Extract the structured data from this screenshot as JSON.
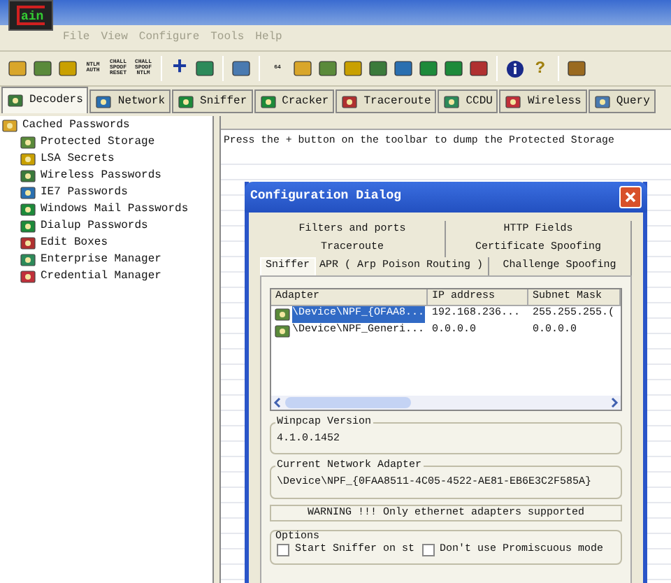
{
  "app": {
    "logo": "ain"
  },
  "menu": [
    "File",
    "View",
    "Configure",
    "Tools",
    "Help"
  ],
  "toolbar": [
    {
      "kind": "icon"
    },
    {
      "kind": "icon"
    },
    {
      "kind": "icon"
    },
    {
      "kind": "text",
      "label": "NTLM AUTH"
    },
    {
      "kind": "text",
      "label": "CHALL SPOOF RESET"
    },
    {
      "kind": "text",
      "label": "CHALL SPOOF NTLM"
    },
    {
      "kind": "sep"
    },
    {
      "kind": "plus",
      "label": "+"
    },
    {
      "kind": "icon"
    },
    {
      "kind": "sep"
    },
    {
      "kind": "icon"
    },
    {
      "kind": "sep"
    },
    {
      "kind": "text",
      "label": "64"
    },
    {
      "kind": "icon"
    },
    {
      "kind": "icon"
    },
    {
      "kind": "icon"
    },
    {
      "kind": "icon"
    },
    {
      "kind": "icon"
    },
    {
      "kind": "icon"
    },
    {
      "kind": "icon"
    },
    {
      "kind": "icon"
    },
    {
      "kind": "sep"
    },
    {
      "kind": "info"
    },
    {
      "kind": "help",
      "label": "?"
    },
    {
      "kind": "sep"
    },
    {
      "kind": "icon"
    }
  ],
  "tabs": [
    {
      "label": "Decoders",
      "selected": true
    },
    {
      "label": "Network",
      "selected": false
    },
    {
      "label": "Sniffer",
      "selected": false
    },
    {
      "label": "Cracker",
      "selected": false
    },
    {
      "label": "Traceroute",
      "selected": false
    },
    {
      "label": "CCDU",
      "selected": false
    },
    {
      "label": "Wireless",
      "selected": false
    },
    {
      "label": "Query",
      "selected": false
    }
  ],
  "tree": {
    "label": "Cached Passwords",
    "children": [
      {
        "label": "Protected Storage"
      },
      {
        "label": "LSA Secrets"
      },
      {
        "label": "Wireless Passwords"
      },
      {
        "label": "IE7 Passwords"
      },
      {
        "label": "Windows Mail Passwords"
      },
      {
        "label": "Dialup Passwords"
      },
      {
        "label": "Edit Boxes"
      },
      {
        "label": "Enterprise Manager"
      },
      {
        "label": "Credential Manager"
      }
    ]
  },
  "content": {
    "message": "Press the + button on the toolbar to dump the Protected Storage"
  },
  "dialog": {
    "title": "Configuration Dialog",
    "tab_rows": [
      [
        {
          "label": "Filters and ports",
          "selected": false
        },
        {
          "label": "HTTP Fields",
          "selected": false
        }
      ],
      [
        {
          "label": "Traceroute",
          "selected": false
        },
        {
          "label": "Certificate Spoofing",
          "selected": false
        }
      ],
      [
        {
          "label": "Sniffer",
          "selected": true
        },
        {
          "label": "APR ( Arp Poison Routing )",
          "selected": false
        },
        {
          "label": "Challenge Spoofing",
          "selected": false
        }
      ]
    ],
    "columns": [
      "Adapter",
      "IP address",
      "Subnet Mask"
    ],
    "rows": [
      {
        "cells": [
          "\\Device\\NPF_{OFAA8...",
          "192.168.236...",
          "255.255.255.("
        ],
        "selected": true
      },
      {
        "cells": [
          "\\Device\\NPF_Generi...",
          "0.0.0.0",
          "0.0.0.0"
        ],
        "selected": false
      }
    ],
    "groups": [
      {
        "title": "Winpcap Version",
        "value": "4.1.0.1452"
      },
      {
        "title": "Current Network Adapter",
        "value": "\\Device\\NPF_{0FAA8511-4C05-4522-AE81-EB6E3C2F585A}"
      }
    ],
    "warning": "WARNING !!! Only ethernet adapters supported",
    "options": {
      "title": "Options",
      "items": [
        {
          "label": "Start Sniffer on st",
          "checked": false
        },
        {
          "label": "Don't use Promiscuous mode",
          "checked": false
        }
      ]
    }
  }
}
